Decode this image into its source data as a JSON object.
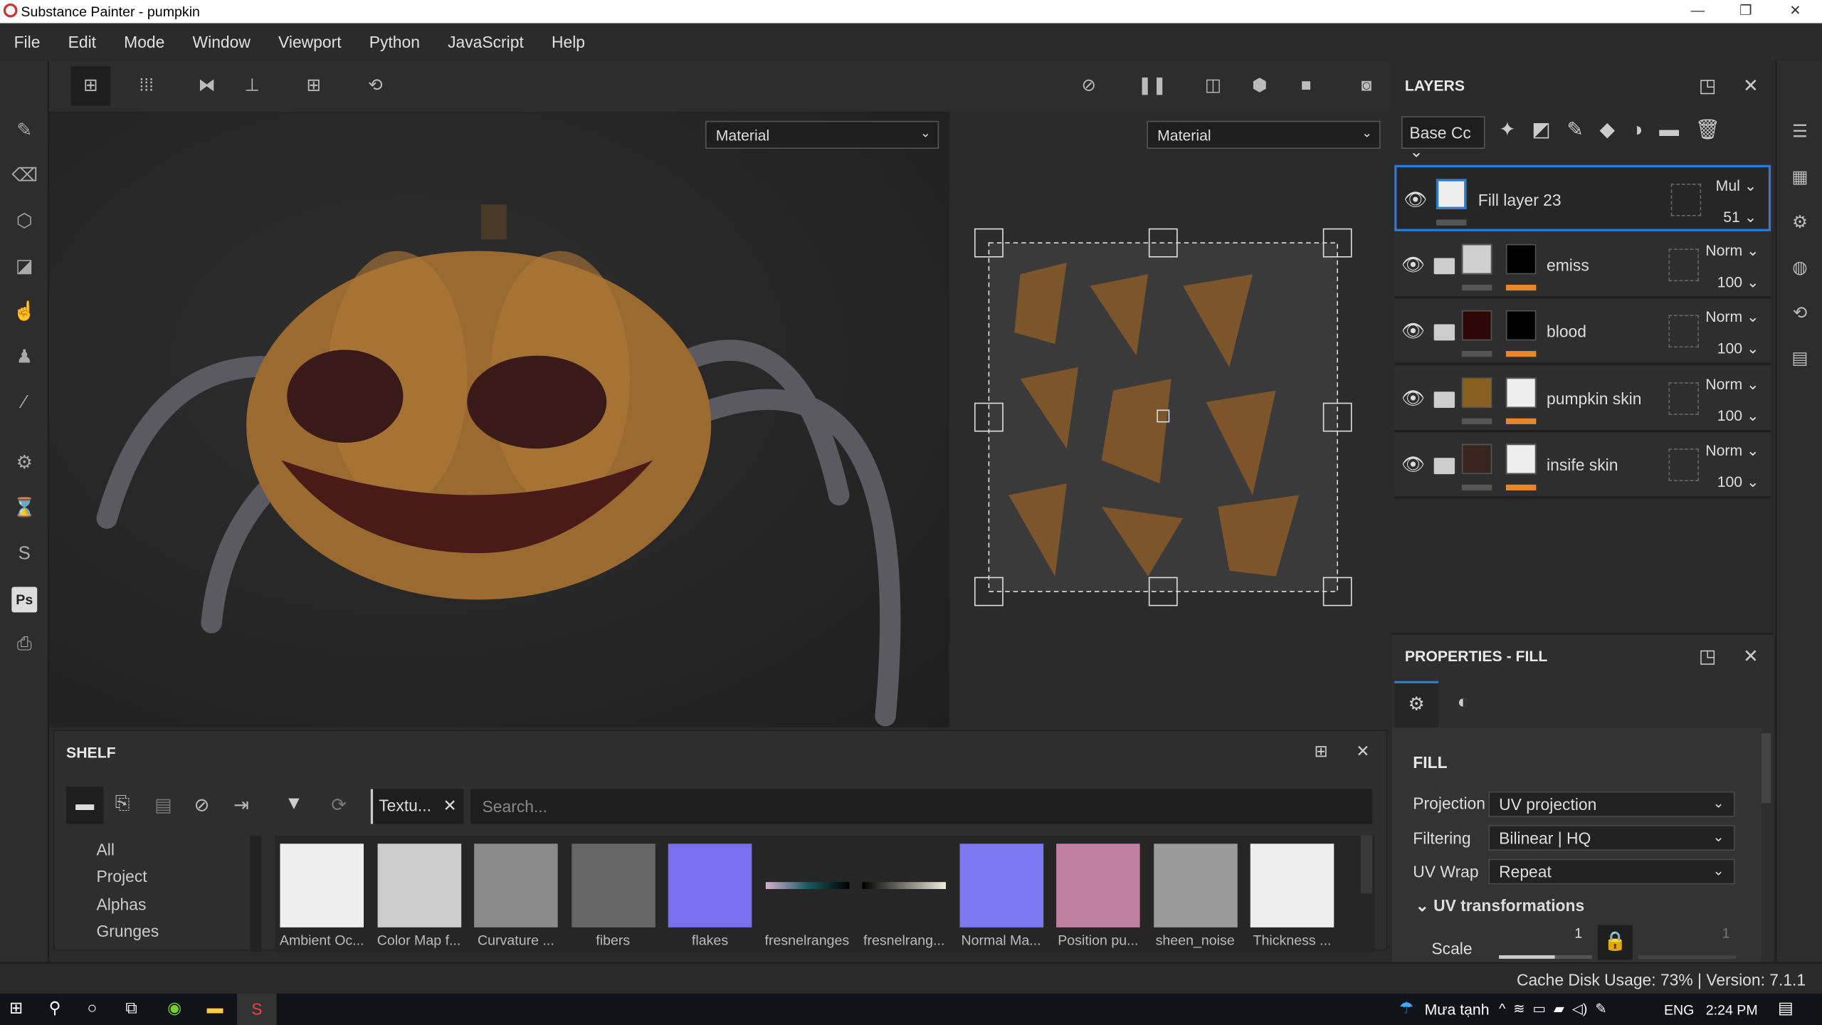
{
  "window": {
    "title": "Substance Painter - pumpkin",
    "minimize": "—",
    "restore": "❐",
    "close": "✕"
  },
  "menu": [
    "File",
    "Edit",
    "Mode",
    "Window",
    "Viewport",
    "Python",
    "JavaScript",
    "Help"
  ],
  "viewport": {
    "left_mode": "Material",
    "right_mode": "Material"
  },
  "shelf": {
    "title": "SHELF",
    "filter_tag": "Textu...",
    "search_placeholder": "Search...",
    "categories": [
      "All",
      "Project",
      "Alphas",
      "Grunges"
    ],
    "items": [
      {
        "label": "Ambient Oc...",
        "color": "#eeeeee"
      },
      {
        "label": "Color Map f...",
        "color": "#cccccc"
      },
      {
        "label": "Curvature ...",
        "color": "#8a8a8a"
      },
      {
        "label": "fibers",
        "color": "#666666"
      },
      {
        "label": "flakes",
        "color": "#7a6ff0"
      },
      {
        "label": "fresnelranges",
        "color": "#1a3a44"
      },
      {
        "label": "fresnelrang...",
        "color": "#999988"
      },
      {
        "label": "Normal Ma...",
        "color": "#7b78f2"
      },
      {
        "label": "Position pu...",
        "color": "#c080a0"
      },
      {
        "label": "sheen_noise",
        "color": "#9a9a9a"
      },
      {
        "label": "Thickness ...",
        "color": "#eeeeee"
      }
    ]
  },
  "layers": {
    "title": "LAYERS",
    "channel": "Base Cc",
    "items": [
      {
        "name": "Fill layer 23",
        "blend": "Mul",
        "opacity": "51",
        "selected": true
      },
      {
        "name": "emiss",
        "blend": "Norm",
        "opacity": "100",
        "color": "#cfcfcf"
      },
      {
        "name": "blood",
        "blend": "Norm",
        "opacity": "100",
        "color": "#2e0808"
      },
      {
        "name": "pumpkin skin",
        "blend": "Norm",
        "opacity": "100",
        "color": "#8a6020"
      },
      {
        "name": "insife skin",
        "blend": "Norm",
        "opacity": "100",
        "color": "#3a2420"
      }
    ]
  },
  "properties": {
    "title": "PROPERTIES - FILL",
    "section": "FILL",
    "projection_label": "Projection",
    "projection": "UV projection",
    "filtering_label": "Filtering",
    "filtering": "Bilinear | HQ",
    "uvwrap_label": "UV Wrap",
    "uvwrap": "Repeat",
    "uvtrans": "UV transformations",
    "scale_label": "Scale",
    "scale_u": "1",
    "scale_v": "1"
  },
  "status": "Cache Disk Usage: 73% | Version: 7.1.1",
  "taskbar": {
    "weather": "Mưa tạnh",
    "lang": "ENG",
    "time": "2:24 PM"
  },
  "colors": {
    "accent": "#2f7ad0",
    "mask_bar": "#e8862a"
  }
}
